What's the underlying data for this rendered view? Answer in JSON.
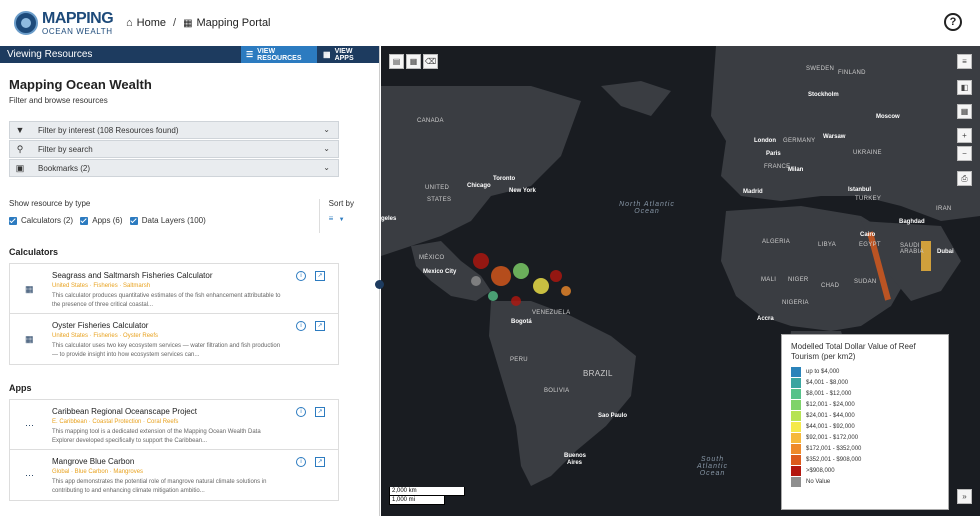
{
  "header": {
    "logo_line1": "MAPPING",
    "logo_line2": "OCEAN WEALTH",
    "home": "Home",
    "portal": "Mapping Portal",
    "help": "?"
  },
  "viewbar": {
    "title": "Viewing Resources",
    "view_resources": "VIEW RESOURCES",
    "view_apps": "VIEW APPS"
  },
  "panel": {
    "title": "Mapping Ocean Wealth",
    "subtitle": "Filter and browse resources",
    "filters": [
      {
        "label": "Filter by interest (108 Resources found)",
        "icon": "funnel-icon"
      },
      {
        "label": "Filter by search",
        "icon": "search-icon"
      },
      {
        "label": "Bookmarks (2)",
        "icon": "bookmark-icon"
      }
    ],
    "type_label": "Show resource by type",
    "types": [
      "Calculators (2)",
      "Apps (6)",
      "Data Layers (100)"
    ],
    "sort_label": "Sort by"
  },
  "sections": {
    "calculators": "Calculators",
    "apps": "Apps"
  },
  "calculators": [
    {
      "title": "Seagrass and Saltmarsh Fisheries Calculator",
      "tags": "United States · Fisheries · Saltmarsh",
      "desc": "This calculator produces quantitative estimates of the fish enhancement attributable to the presence of three critical coastal..."
    },
    {
      "title": "Oyster Fisheries Calculator",
      "tags": "United States · Fisheries · Oyster Reefs",
      "desc": "This calculator uses two key ecosystem services — water filtration and fish production — to provide insight into how ecosystem services can..."
    }
  ],
  "apps": [
    {
      "title": "Caribbean Regional Oceanscape Project",
      "tags": "E. Caribbean · Coastal Protection · Coral Reefs",
      "desc": "This mapping tool is a dedicated extension of the Mapping Ocean Wealth Data Explorer developed specifically to support the Caribbean..."
    },
    {
      "title": "Mangrove Blue Carbon",
      "tags": "Global · Blue Carbon · Mangroves",
      "desc": "This app demonstrates the potential role of mangrove natural climate solutions in contributing to and enhancing climate mitigation ambitio..."
    }
  ],
  "map_labels": {
    "sweden": "SWEDEN",
    "finland": "FINLAND",
    "stockholm": "Stockholm",
    "moscow": "Moscow",
    "canada": "CANADA",
    "warsaw": "Warsaw",
    "london": "London",
    "germany": "GERMANY",
    "paris": "Paris",
    "ukraine": "UKRAINE",
    "milan": "Milan",
    "france": "FRANCE",
    "toronto": "Toronto",
    "chicago": "Chicago",
    "newyork": "New York",
    "united1": "UNITED",
    "states": "STATES",
    "madrid": "Madrid",
    "istanbul": "Istanbul",
    "turkey": "TURKEY",
    "iran": "IRAN",
    "baghdad": "Baghdad",
    "angeles": "geles",
    "north_atlantic": "North Atlantic Ocean",
    "cairo": "Cairo",
    "saudi": "SAUDI ARABIA",
    "dubai": "Dubai",
    "algeria": "ALGERIA",
    "libya": "LIBYA",
    "egypt": "EGYPT",
    "mexico": "MÉXICO",
    "mexico_city": "Mexico City",
    "mali": "MALI",
    "niger": "NIGER",
    "chad": "CHAD",
    "sudan": "SUDAN",
    "nigeria": "NIGERIA",
    "bogota": "Bogotá",
    "venezuela": "VENEZUELA",
    "accra": "Accra",
    "peru": "PERU",
    "brazil": "BRAZIL",
    "bolivia": "BOLIVIA",
    "saopaulo": "Sao Paulo",
    "buenos": "Buenos",
    "aires": "Aires",
    "south_atlantic": "South Atlantic Ocean"
  },
  "legend": {
    "title": "Modelled Total Dollar Value of Reef Tourism (per km2)",
    "items": [
      {
        "label": "up to $4,000",
        "color": "#2b83ba"
      },
      {
        "label": "$4,001 - $8,000",
        "color": "#3aa5a0"
      },
      {
        "label": "$8,001 - $12,000",
        "color": "#56c28a"
      },
      {
        "label": "$12,001 - $24,000",
        "color": "#7fd36a"
      },
      {
        "label": "$24,001 - $44,000",
        "color": "#b6e354"
      },
      {
        "label": "$44,001 - $92,000",
        "color": "#f5e94a"
      },
      {
        "label": "$92,001 - $172,000",
        "color": "#f6b93b"
      },
      {
        "label": "$172,001 - $352,000",
        "color": "#ee8a2a"
      },
      {
        "label": "$352,001 - $908,000",
        "color": "#dc5a1c"
      },
      {
        "label": ">$908,000",
        "color": "#b3170f"
      },
      {
        "label": "No Value",
        "color": "#8f8f8f"
      }
    ]
  },
  "scale": {
    "km": "2,000 km",
    "mi": "1,000 mi"
  }
}
